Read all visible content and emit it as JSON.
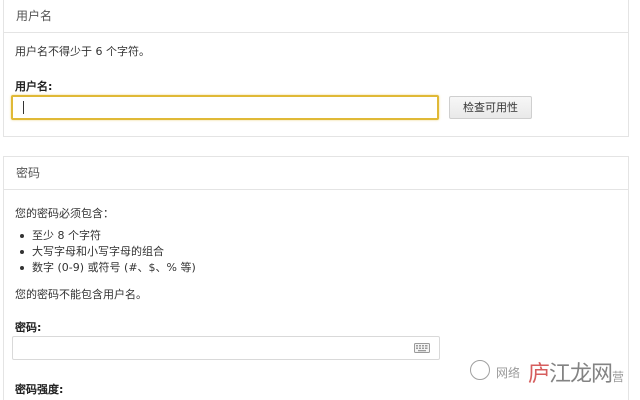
{
  "username_panel": {
    "title": "用户名",
    "hint": "用户名不得少于 6 个字符。",
    "label": "用户名:",
    "input_value": "",
    "check_button": "检查可用性"
  },
  "password_panel": {
    "title": "密码",
    "intro": "您的密码必须包含：",
    "rules": [
      "至少 8 个字符",
      "大写字母和小写字母的组合",
      "数字 (0-9) 或符号 (#、$、% 等)"
    ],
    "note": "您的密码不能包含用户名。",
    "label": "密码:",
    "input_value": "",
    "strength_label": "密码强度:"
  },
  "watermark": {
    "small_text": "网络",
    "brand_first": "庐",
    "brand_rest": "江龙网",
    "suffix": "营"
  },
  "colors": {
    "focus_border": "#e0b936",
    "panel_border": "#e4e4e4",
    "button_bg": "#ececec"
  }
}
